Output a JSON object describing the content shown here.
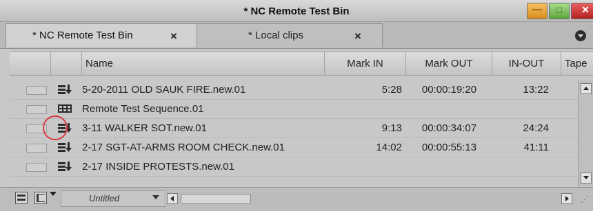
{
  "window": {
    "title": "* NC Remote Test Bin",
    "min_glyph": "—",
    "max_glyph": "□",
    "close_glyph": "✕"
  },
  "tabs": [
    {
      "label": "* NC Remote Test Bin",
      "close": "×",
      "active": true
    },
    {
      "label": "* Local clips",
      "close": "×",
      "active": false
    }
  ],
  "columns": {
    "name": "Name",
    "mark_in": "Mark IN",
    "mark_out": "Mark OUT",
    "in_out": "IN-OUT",
    "tape": "Tape"
  },
  "rows": [
    {
      "icon": "masterclip-icon",
      "name": "5-20-2011 OLD SAUK FIRE.new.01",
      "mark_in": "5:28",
      "mark_out": "00:00:19:20",
      "in_out": "13:22"
    },
    {
      "icon": "sequence-icon",
      "name": "Remote Test Sequence.01",
      "mark_in": "",
      "mark_out": "",
      "in_out": ""
    },
    {
      "icon": "masterclip-icon",
      "name": "3-11 WALKER SOT.new.01",
      "mark_in": "9:13",
      "mark_out": "00:00:34:07",
      "in_out": "24:24"
    },
    {
      "icon": "masterclip-icon",
      "name": "2-17 SGT-AT-ARMS ROOM CHECK.new.01",
      "mark_in": "14:02",
      "mark_out": "00:00:55:13",
      "in_out": "41:11"
    },
    {
      "icon": "masterclip-icon",
      "name": "2-17 INSIDE PROTESTS.new.01",
      "mark_in": "",
      "mark_out": "",
      "in_out": ""
    }
  ],
  "footer": {
    "bin_view": "Untitled"
  },
  "colors": {
    "highlight_circle": "#d73a40",
    "close_button": "#c33030",
    "minimize_button": "#e0a030",
    "maximize_button": "#7cc35a"
  }
}
